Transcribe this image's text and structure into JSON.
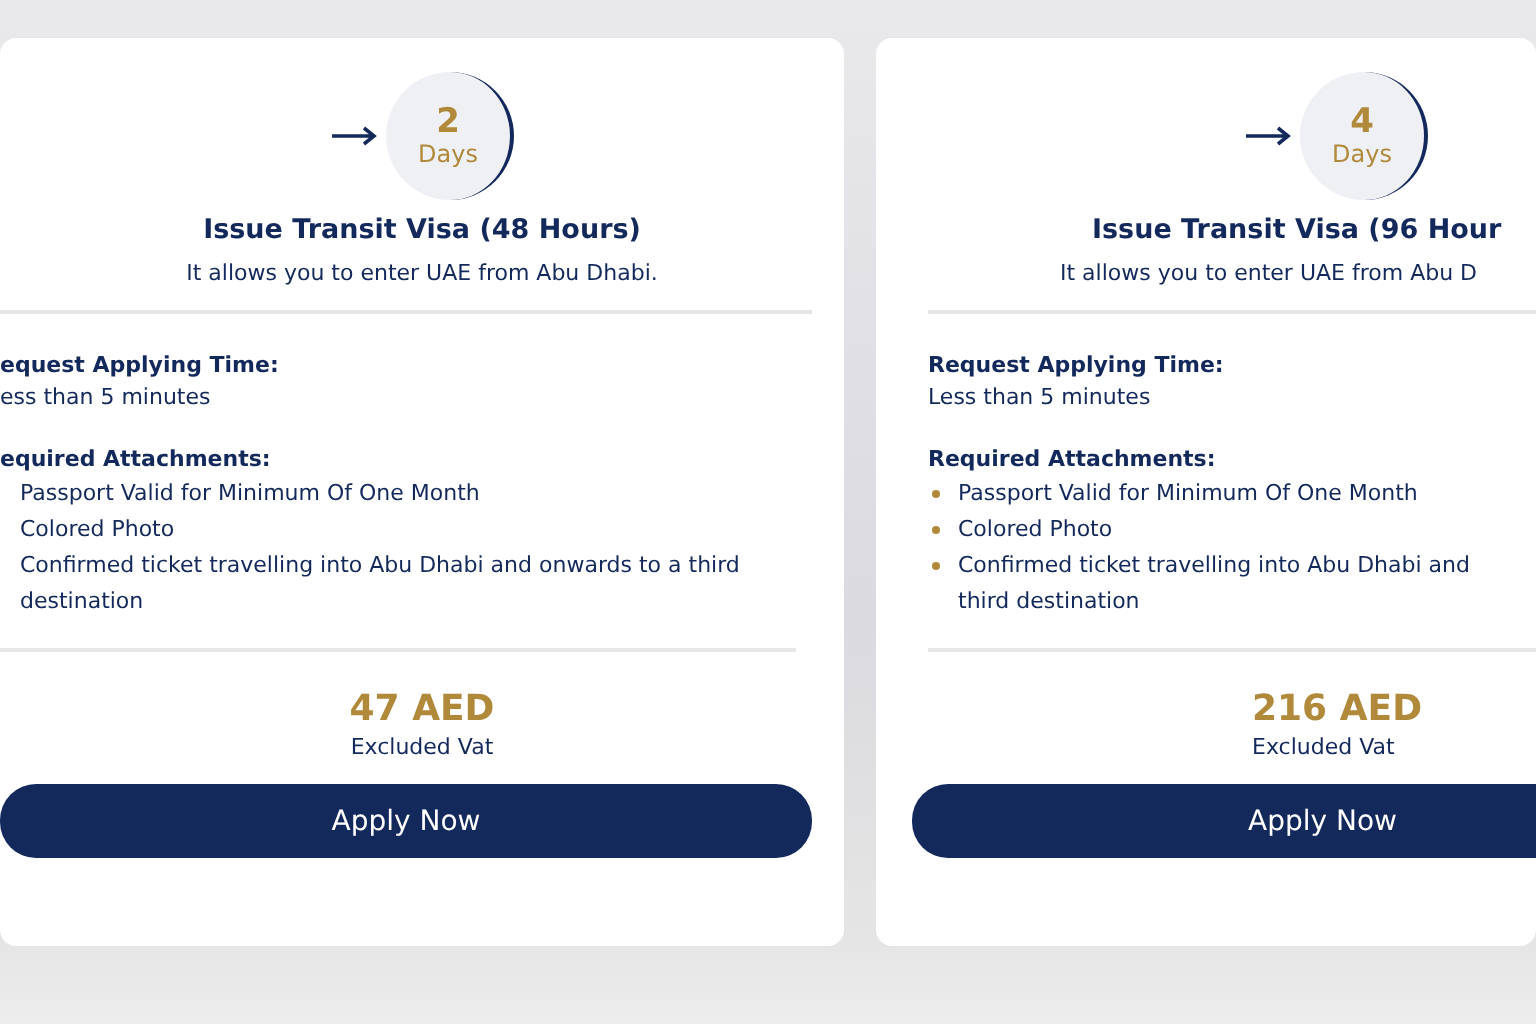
{
  "cards": [
    {
      "days": "2",
      "days_unit": "Days",
      "title": "Issue Transit Visa (48 Hours)",
      "subtitle": "It allows you to enter UAE from Abu Dhabi.",
      "time_label": "equest Applying Time:",
      "time_value": "ess than 5 minutes",
      "attachments_label": "equired Attachments:",
      "bulleted": false,
      "attachments": [
        "Passport Valid for Minimum Of One Month",
        "Colored Photo",
        "Confirmed ticket travelling into Abu Dhabi and onwards to a third destination"
      ],
      "price": "47 AED",
      "price_note": "Excluded Vat",
      "button": "Apply Now"
    },
    {
      "days": "4",
      "days_unit": "Days",
      "title": "Issue Transit Visa (96 Hour",
      "subtitle": "It allows you to enter UAE from Abu D",
      "time_label": "Request Applying Time:",
      "time_value": "Less than 5 minutes",
      "attachments_label": "Required Attachments:",
      "bulleted": true,
      "attachments": [
        "Passport Valid for Minimum Of One Month",
        "Colored Photo",
        "Confirmed ticket travelling into Abu Dhabi and\nthird destination"
      ],
      "price": "216 AED",
      "price_note": "Excluded Vat",
      "button": "Apply Now"
    }
  ]
}
